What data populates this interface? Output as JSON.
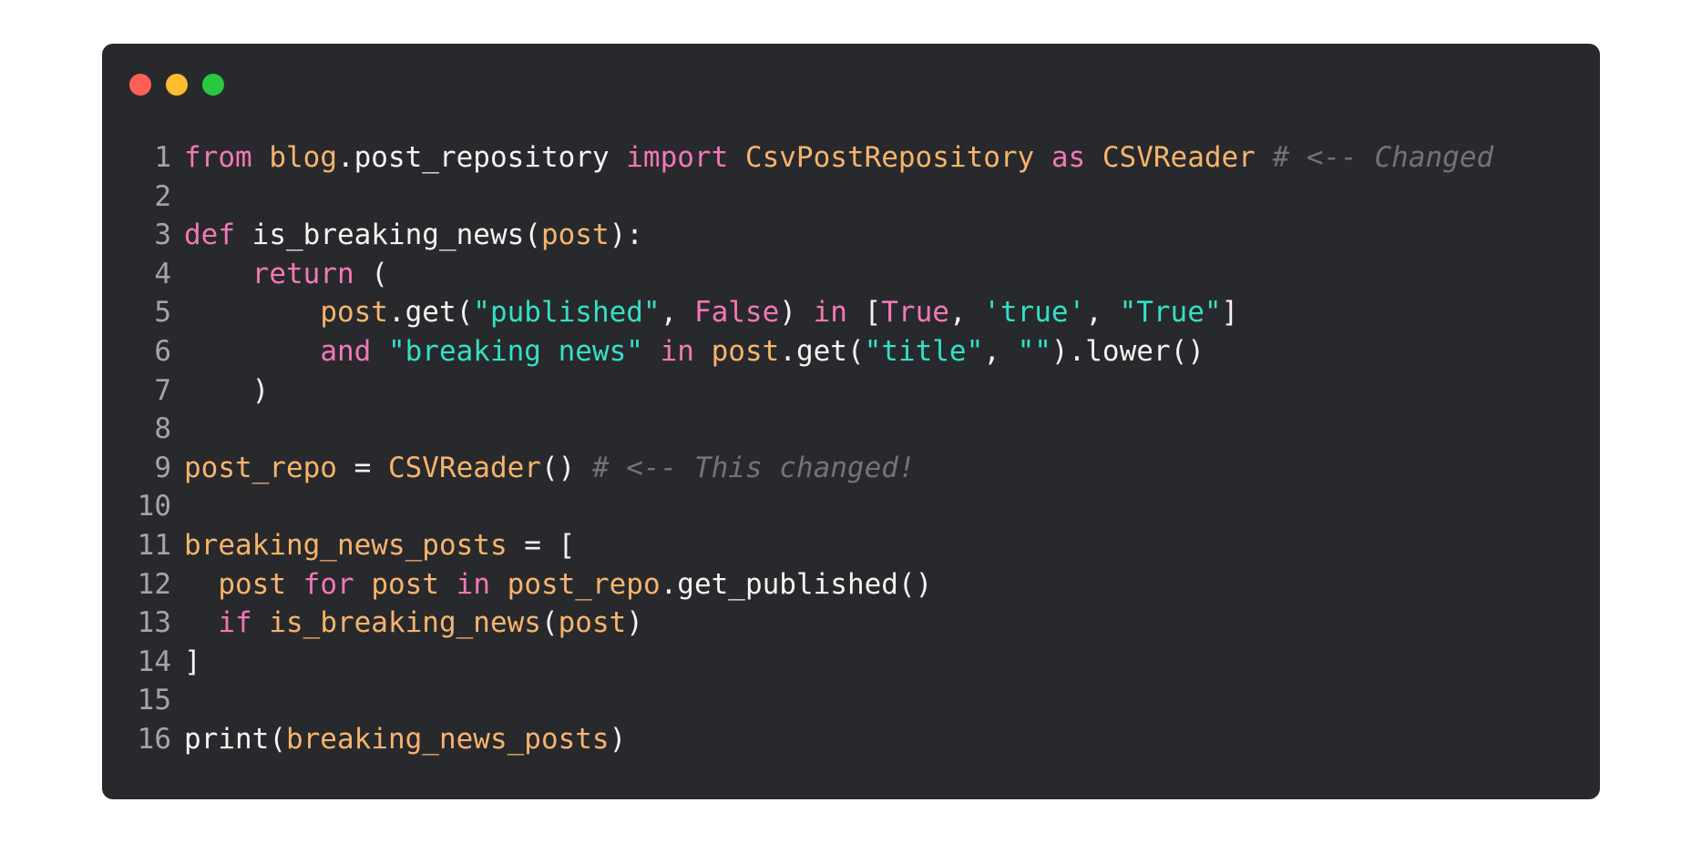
{
  "window": {
    "traffic_lights": [
      {
        "name": "close",
        "color": "#ff5f57"
      },
      {
        "name": "minimize",
        "color": "#febc2e"
      },
      {
        "name": "maximize",
        "color": "#28c840"
      }
    ]
  },
  "colors": {
    "background": "#28292c",
    "keyword": "#f178b6",
    "variable": "#f7b46c",
    "string": "#32e0c6",
    "comment": "#72737a",
    "text": "#f4f4f2",
    "line_number": "#a4a5a8"
  },
  "code": {
    "language": "python",
    "lines": [
      {
        "number": "1",
        "tokens": [
          {
            "t": "kw",
            "v": "from"
          },
          {
            "t": "p",
            "v": " "
          },
          {
            "t": "var",
            "v": "blog"
          },
          {
            "t": "p",
            "v": ".post_repository "
          },
          {
            "t": "kw",
            "v": "import"
          },
          {
            "t": "p",
            "v": " "
          },
          {
            "t": "var",
            "v": "CsvPostRepository"
          },
          {
            "t": "p",
            "v": " "
          },
          {
            "t": "kw",
            "v": "as"
          },
          {
            "t": "p",
            "v": " "
          },
          {
            "t": "var",
            "v": "CSVReader"
          },
          {
            "t": "p",
            "v": " "
          },
          {
            "t": "cm",
            "v": "# <-- Changed"
          }
        ]
      },
      {
        "number": "2",
        "tokens": []
      },
      {
        "number": "3",
        "tokens": [
          {
            "t": "kw",
            "v": "def"
          },
          {
            "t": "p",
            "v": " is_breaking_news("
          },
          {
            "t": "var",
            "v": "post"
          },
          {
            "t": "p",
            "v": "):"
          }
        ]
      },
      {
        "number": "4",
        "tokens": [
          {
            "t": "p",
            "v": "    "
          },
          {
            "t": "kw",
            "v": "return"
          },
          {
            "t": "p",
            "v": " ("
          }
        ]
      },
      {
        "number": "5",
        "tokens": [
          {
            "t": "p",
            "v": "        "
          },
          {
            "t": "var",
            "v": "post"
          },
          {
            "t": "p",
            "v": ".get("
          },
          {
            "t": "str",
            "v": "\"published\""
          },
          {
            "t": "p",
            "v": ", "
          },
          {
            "t": "kw",
            "v": "False"
          },
          {
            "t": "p",
            "v": ") "
          },
          {
            "t": "kw",
            "v": "in"
          },
          {
            "t": "p",
            "v": " ["
          },
          {
            "t": "kw",
            "v": "True"
          },
          {
            "t": "p",
            "v": ", "
          },
          {
            "t": "str",
            "v": "'true'"
          },
          {
            "t": "p",
            "v": ", "
          },
          {
            "t": "str",
            "v": "\"True\""
          },
          {
            "t": "p",
            "v": "]"
          }
        ]
      },
      {
        "number": "6",
        "tokens": [
          {
            "t": "p",
            "v": "        "
          },
          {
            "t": "kw",
            "v": "and"
          },
          {
            "t": "p",
            "v": " "
          },
          {
            "t": "str",
            "v": "\"breaking news\""
          },
          {
            "t": "p",
            "v": " "
          },
          {
            "t": "kw",
            "v": "in"
          },
          {
            "t": "p",
            "v": " "
          },
          {
            "t": "var",
            "v": "post"
          },
          {
            "t": "p",
            "v": ".get("
          },
          {
            "t": "str",
            "v": "\"title\""
          },
          {
            "t": "p",
            "v": ", "
          },
          {
            "t": "str",
            "v": "\"\""
          },
          {
            "t": "p",
            "v": ").lower()"
          }
        ]
      },
      {
        "number": "7",
        "tokens": [
          {
            "t": "p",
            "v": "    )"
          }
        ]
      },
      {
        "number": "8",
        "tokens": []
      },
      {
        "number": "9",
        "tokens": [
          {
            "t": "var",
            "v": "post_repo"
          },
          {
            "t": "p",
            "v": " = "
          },
          {
            "t": "var",
            "v": "CSVReader"
          },
          {
            "t": "p",
            "v": "() "
          },
          {
            "t": "cm",
            "v": "# <-- This changed!"
          }
        ]
      },
      {
        "number": "10",
        "tokens": []
      },
      {
        "number": "11",
        "tokens": [
          {
            "t": "var",
            "v": "breaking_news_posts"
          },
          {
            "t": "p",
            "v": " = ["
          }
        ]
      },
      {
        "number": "12",
        "tokens": [
          {
            "t": "p",
            "v": "  "
          },
          {
            "t": "var",
            "v": "post"
          },
          {
            "t": "p",
            "v": " "
          },
          {
            "t": "kw",
            "v": "for"
          },
          {
            "t": "p",
            "v": " "
          },
          {
            "t": "var",
            "v": "post"
          },
          {
            "t": "p",
            "v": " "
          },
          {
            "t": "kw",
            "v": "in"
          },
          {
            "t": "p",
            "v": " "
          },
          {
            "t": "var",
            "v": "post_repo"
          },
          {
            "t": "p",
            "v": ".get_published()"
          }
        ]
      },
      {
        "number": "13",
        "tokens": [
          {
            "t": "p",
            "v": "  "
          },
          {
            "t": "kw",
            "v": "if"
          },
          {
            "t": "p",
            "v": " "
          },
          {
            "t": "var",
            "v": "is_breaking_news"
          },
          {
            "t": "p",
            "v": "("
          },
          {
            "t": "var",
            "v": "post"
          },
          {
            "t": "p",
            "v": ")"
          }
        ]
      },
      {
        "number": "14",
        "tokens": [
          {
            "t": "p",
            "v": "]"
          }
        ]
      },
      {
        "number": "15",
        "tokens": []
      },
      {
        "number": "16",
        "tokens": [
          {
            "t": "p",
            "v": "print("
          },
          {
            "t": "var",
            "v": "breaking_news_posts"
          },
          {
            "t": "p",
            "v": ")"
          }
        ]
      }
    ]
  }
}
